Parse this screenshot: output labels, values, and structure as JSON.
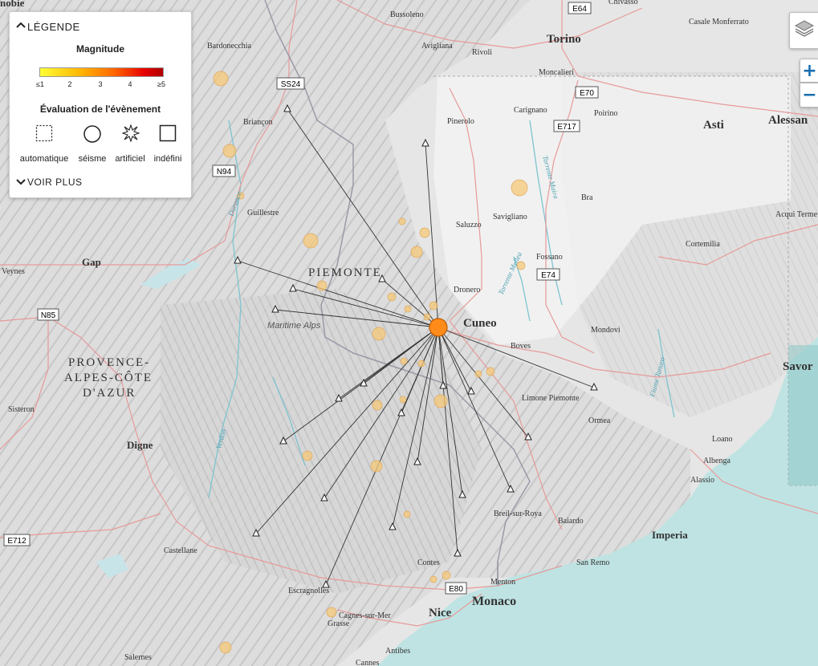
{
  "legend": {
    "title": "LÉGENDE",
    "magnitude_title": "Magnitude",
    "magnitude_ticks": [
      "≤1",
      "2",
      "3",
      "4",
      "≥5"
    ],
    "evaluation_title": "Évaluation de l'évènement",
    "symbols": [
      "automatique",
      "séisme",
      "artificiel",
      "indéfini"
    ],
    "more": "VOIR PLUS"
  },
  "controls": {
    "zoom_in": "+",
    "zoom_out": "−"
  },
  "colors": {
    "event": "#ff8c1a",
    "minor_event": "#f5c878",
    "sea": "#bfe3e3",
    "roads": "#e79a9a"
  },
  "places": [
    {
      "name": "Torino",
      "bold": true
    },
    {
      "name": "Asti",
      "bold": true
    },
    {
      "name": "Alessan",
      "bold": true
    },
    {
      "name": "Cuneo",
      "bold": true
    },
    {
      "name": "Monaco",
      "bold": true
    },
    {
      "name": "Nice",
      "bold": true
    },
    {
      "name": "Savor",
      "bold": true
    },
    {
      "name": "Gap",
      "bold": true
    },
    {
      "name": "Digne",
      "bold": true
    },
    {
      "name": "Imperia",
      "bold": true
    },
    {
      "name": "Bussoleno"
    },
    {
      "name": "Avigliana"
    },
    {
      "name": "Rivoli"
    },
    {
      "name": "Casale Monferrato"
    },
    {
      "name": "Chivasso"
    },
    {
      "name": "Bardonecchia"
    },
    {
      "name": "Moncalieri"
    },
    {
      "name": "Carignano"
    },
    {
      "name": "Poirino"
    },
    {
      "name": "Pinerolo"
    },
    {
      "name": "Briançon"
    },
    {
      "name": "Bra"
    },
    {
      "name": "Savigliano"
    },
    {
      "name": "Saluzzo"
    },
    {
      "name": "Guillestre"
    },
    {
      "name": "Acqui Terme"
    },
    {
      "name": "Cortemilia"
    },
    {
      "name": "Fossano"
    },
    {
      "name": "Dronero"
    },
    {
      "name": "Veynes"
    },
    {
      "name": "Mondovì"
    },
    {
      "name": "Boves"
    },
    {
      "name": "Limone Piemonte"
    },
    {
      "name": "Ormea"
    },
    {
      "name": "Sisteron"
    },
    {
      "name": "Loano"
    },
    {
      "name": "Albenga"
    },
    {
      "name": "Alassio"
    },
    {
      "name": "Breil-sur-Roya"
    },
    {
      "name": "Baiardo"
    },
    {
      "name": "San Remo"
    },
    {
      "name": "Castellane"
    },
    {
      "name": "Contes"
    },
    {
      "name": "Menton"
    },
    {
      "name": "Escragnolles"
    },
    {
      "name": "Cagnes-sur-Mer"
    },
    {
      "name": "Grasse"
    },
    {
      "name": "Antibes"
    },
    {
      "name": "Salernes"
    },
    {
      "name": "Cannes"
    },
    {
      "name": "nobie"
    }
  ],
  "regions": [
    "PIEMONTE",
    "PROVENCE-",
    "ALPES-CÔTE",
    "D'AZUR"
  ],
  "features": [
    "Maritime Alps",
    "Durance",
    "Torrente Maira",
    "Torrente Mellea",
    "Fiume Tanaro",
    "Verdon"
  ],
  "road_shields": [
    "E64",
    "SS24",
    "E70",
    "E717",
    "N94",
    "E74",
    "N85",
    "E712",
    "E80"
  ]
}
